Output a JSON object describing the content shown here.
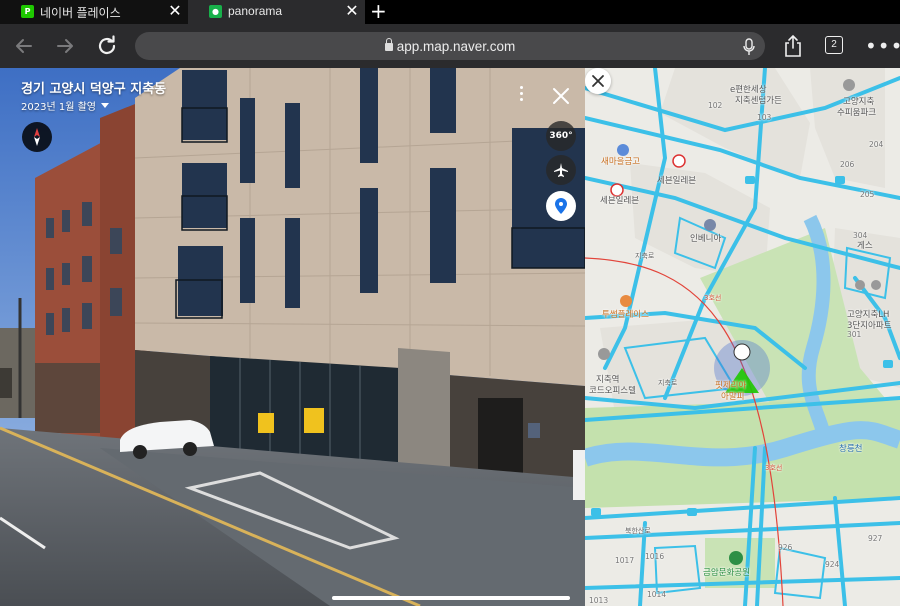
{
  "tabs": [
    {
      "title": "네이버 플레이스",
      "favicon": "naver-place-icon",
      "active": false
    },
    {
      "title": "panorama",
      "favicon": "naver-map-pin-icon",
      "active": true
    }
  ],
  "toolbar": {
    "url": "app.map.naver.com",
    "tab_count": "2"
  },
  "panorama": {
    "location_title": "경기 고양시 덕양구 지축동",
    "capture_date": "2023년 1월 촬영",
    "btn_360": "360°"
  },
  "map": {
    "labels": {
      "e_apt": "e편한세상",
      "e_apt2": "지축센텀가든",
      "suppiarhill": "고양지축",
      "suppiarhill2": "수피움파크",
      "saemaeul": "새마을금고",
      "seven1": "세븐일레븐",
      "seven2": "세븐일레븐",
      "invenia": "인베니아",
      "tusum": "투썸플레이스",
      "lh1": "고양지축LH",
      "lh2": "3단지아파트",
      "coex1": "지축역",
      "coex2": "코드오피스텔",
      "pizza1": "핏제리아",
      "pizza2": "아말피",
      "creek": "창릉천",
      "park": "금암문화공원",
      "jichukro": "지축로",
      "jichukro2": "지축로",
      "bukhan": "북한산로",
      "road3": "3호선",
      "road3b": "3호선",
      "ges": "게스",
      "n102": "102",
      "n103": "103",
      "n204": "204",
      "n205": "205",
      "n206": "206",
      "n304": "304",
      "n301": "301",
      "n926": "926",
      "n927": "927",
      "n924": "924",
      "n1016": "1016",
      "n1017": "1017",
      "n1014": "1014",
      "n1013": "1013"
    }
  },
  "colors": {
    "road": "#3cc0e8",
    "park": "#b7dca0",
    "water": "#7fc1ea",
    "route": "#e2443a",
    "street_view_marker": "#1ec800"
  }
}
